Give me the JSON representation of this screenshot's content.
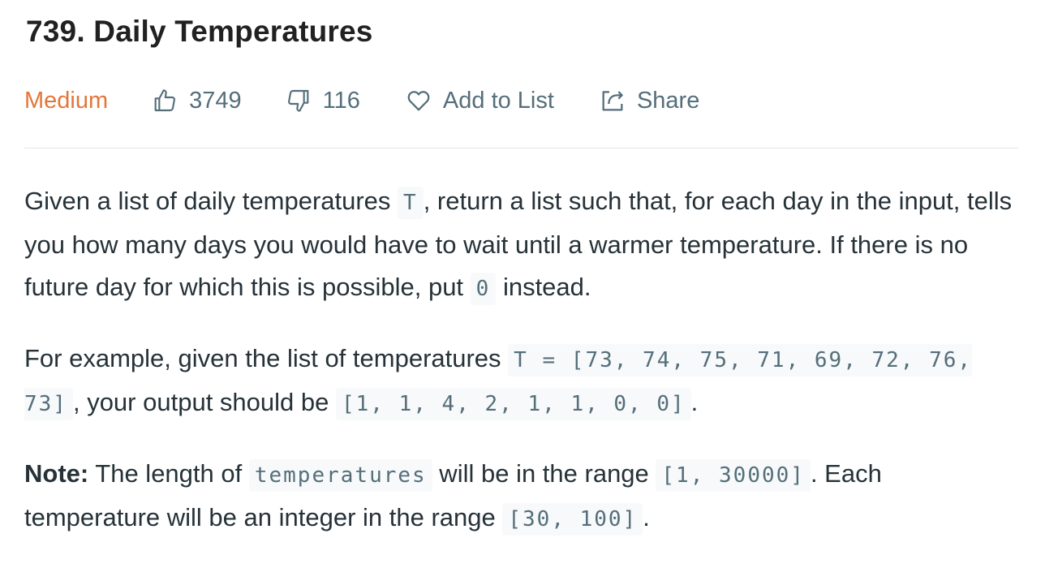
{
  "problem": {
    "title": "739. Daily Temperatures",
    "difficulty": "Medium",
    "likes": "3749",
    "dislikes": "116",
    "add_to_list_label": "Add to List",
    "share_label": "Share"
  },
  "description": {
    "p1": {
      "part1": "Given a list of daily temperatures ",
      "code1": "T",
      "part2": ", return a list such that, for each day in the input, tells you how many days you would have to wait until a warmer temperature. If there is no future day for which this is possible, put ",
      "code2": "0",
      "part3": " instead."
    },
    "p2": {
      "part1": "For example, given the list of temperatures ",
      "code1": "T = [73, 74, 75, 71, 69, 72, 76, 73]",
      "part2": ", your output should be ",
      "code2": "[1, 1, 4, 2, 1, 1, 0, 0]",
      "part3": "."
    },
    "p3": {
      "label": "Note:",
      "part1": " The length of ",
      "code1": "temperatures",
      "part2": " will be in the range ",
      "code2": "[1, 30000]",
      "part3": ". Each temperature will be an integer in the range ",
      "code3": "[30, 100]",
      "part4": "."
    }
  },
  "colors": {
    "difficulty_medium": "#e2773a",
    "meta_text": "#546e7a",
    "code_bg": "#f7f9fa"
  },
  "icons": {
    "like": "thumbs-up-icon",
    "dislike": "thumbs-down-icon",
    "add_to_list": "heart-icon",
    "share": "share-icon"
  }
}
